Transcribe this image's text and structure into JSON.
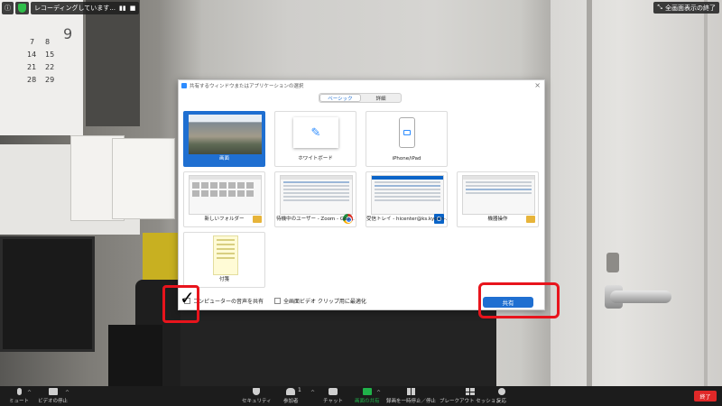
{
  "top_bar": {
    "recording_text": "レコーディングしています...",
    "pause_symbol": "▮▮",
    "stop_symbol": "■",
    "fullscreen_exit_label": "全画面表示の終了"
  },
  "background": {
    "calendar_numbers": [
      "9",
      "7",
      "8",
      "14",
      "15",
      "21",
      "22",
      "28",
      "29"
    ]
  },
  "dialog": {
    "title": "共有するウィンドウまたはアプリケーションの選択",
    "close_symbol": "×",
    "tabs": [
      {
        "label": "ベーシック",
        "active": true
      },
      {
        "label": "詳細",
        "active": false
      }
    ],
    "tiles": [
      {
        "label": "画面",
        "kind": "screen",
        "selected": true
      },
      {
        "label": "ホワイトボード",
        "kind": "whiteboard",
        "selected": false
      },
      {
        "label": "iPhone/iPad",
        "kind": "iphone",
        "selected": false
      },
      {
        "label": "新しいフォルダー",
        "kind": "window",
        "app_icon": "folder-icon",
        "selected": false
      },
      {
        "label": "待機中のユーザー - Zoom - Goo...",
        "kind": "window",
        "app_icon": "chrome-icon",
        "selected": false
      },
      {
        "label": "受信トレイ - hicenter@ks.kyorin-...",
        "kind": "window",
        "app_icon": "outlook-icon",
        "selected": false
      },
      {
        "label": "機器操作",
        "kind": "window",
        "app_icon": "folder-icon",
        "selected": false
      },
      {
        "label": "付箋",
        "kind": "sticky",
        "selected": false
      }
    ],
    "share_audio_label": "コンピューターの音声を共有",
    "optimize_video_label": "全画面ビデオ クリップ用に最適化",
    "share_button": "共有",
    "share_audio_checked": true,
    "optimize_video_checked": false
  },
  "toolbar": {
    "mute": "ミュート",
    "stop_video": "ビデオの停止",
    "security": "セキュリティ",
    "participants": "参加者",
    "participant_count": "1",
    "chat": "チャット",
    "share_screen": "画面の共有",
    "record": "録画を一時停止／停止",
    "breakout": "ブレークアウト セッション",
    "reactions": "反応",
    "end": "終了"
  },
  "colors": {
    "accent": "#1f6fd1",
    "highlight": "#e8141c",
    "end_button": "#e02828",
    "share_icon": "#20b24a"
  }
}
